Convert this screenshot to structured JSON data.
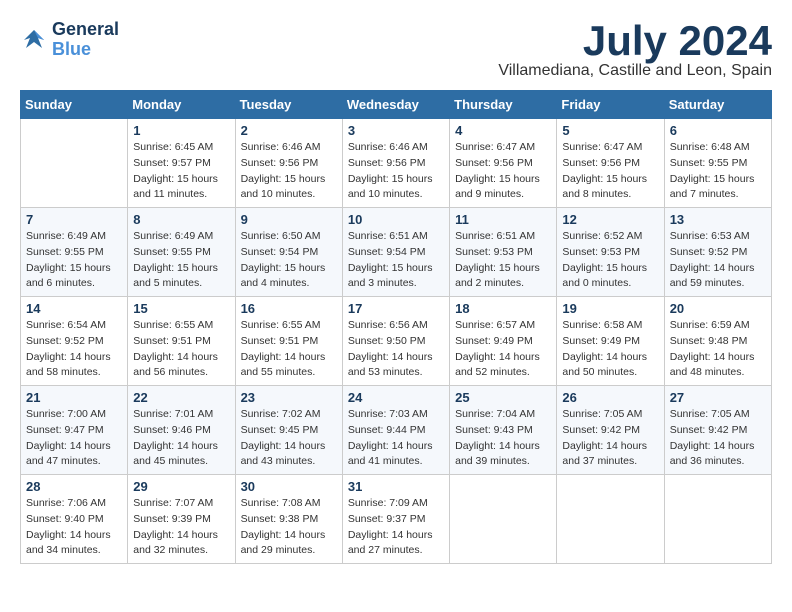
{
  "header": {
    "logo_line1": "General",
    "logo_line2": "Blue",
    "month_title": "July 2024",
    "location": "Villamediana, Castille and Leon, Spain"
  },
  "columns": [
    "Sunday",
    "Monday",
    "Tuesday",
    "Wednesday",
    "Thursday",
    "Friday",
    "Saturday"
  ],
  "weeks": [
    [
      {
        "day": "",
        "info": ""
      },
      {
        "day": "1",
        "info": "Sunrise: 6:45 AM\nSunset: 9:57 PM\nDaylight: 15 hours\nand 11 minutes."
      },
      {
        "day": "2",
        "info": "Sunrise: 6:46 AM\nSunset: 9:56 PM\nDaylight: 15 hours\nand 10 minutes."
      },
      {
        "day": "3",
        "info": "Sunrise: 6:46 AM\nSunset: 9:56 PM\nDaylight: 15 hours\nand 10 minutes."
      },
      {
        "day": "4",
        "info": "Sunrise: 6:47 AM\nSunset: 9:56 PM\nDaylight: 15 hours\nand 9 minutes."
      },
      {
        "day": "5",
        "info": "Sunrise: 6:47 AM\nSunset: 9:56 PM\nDaylight: 15 hours\nand 8 minutes."
      },
      {
        "day": "6",
        "info": "Sunrise: 6:48 AM\nSunset: 9:55 PM\nDaylight: 15 hours\nand 7 minutes."
      }
    ],
    [
      {
        "day": "7",
        "info": "Sunrise: 6:49 AM\nSunset: 9:55 PM\nDaylight: 15 hours\nand 6 minutes."
      },
      {
        "day": "8",
        "info": "Sunrise: 6:49 AM\nSunset: 9:55 PM\nDaylight: 15 hours\nand 5 minutes."
      },
      {
        "day": "9",
        "info": "Sunrise: 6:50 AM\nSunset: 9:54 PM\nDaylight: 15 hours\nand 4 minutes."
      },
      {
        "day": "10",
        "info": "Sunrise: 6:51 AM\nSunset: 9:54 PM\nDaylight: 15 hours\nand 3 minutes."
      },
      {
        "day": "11",
        "info": "Sunrise: 6:51 AM\nSunset: 9:53 PM\nDaylight: 15 hours\nand 2 minutes."
      },
      {
        "day": "12",
        "info": "Sunrise: 6:52 AM\nSunset: 9:53 PM\nDaylight: 15 hours\nand 0 minutes."
      },
      {
        "day": "13",
        "info": "Sunrise: 6:53 AM\nSunset: 9:52 PM\nDaylight: 14 hours\nand 59 minutes."
      }
    ],
    [
      {
        "day": "14",
        "info": "Sunrise: 6:54 AM\nSunset: 9:52 PM\nDaylight: 14 hours\nand 58 minutes."
      },
      {
        "day": "15",
        "info": "Sunrise: 6:55 AM\nSunset: 9:51 PM\nDaylight: 14 hours\nand 56 minutes."
      },
      {
        "day": "16",
        "info": "Sunrise: 6:55 AM\nSunset: 9:51 PM\nDaylight: 14 hours\nand 55 minutes."
      },
      {
        "day": "17",
        "info": "Sunrise: 6:56 AM\nSunset: 9:50 PM\nDaylight: 14 hours\nand 53 minutes."
      },
      {
        "day": "18",
        "info": "Sunrise: 6:57 AM\nSunset: 9:49 PM\nDaylight: 14 hours\nand 52 minutes."
      },
      {
        "day": "19",
        "info": "Sunrise: 6:58 AM\nSunset: 9:49 PM\nDaylight: 14 hours\nand 50 minutes."
      },
      {
        "day": "20",
        "info": "Sunrise: 6:59 AM\nSunset: 9:48 PM\nDaylight: 14 hours\nand 48 minutes."
      }
    ],
    [
      {
        "day": "21",
        "info": "Sunrise: 7:00 AM\nSunset: 9:47 PM\nDaylight: 14 hours\nand 47 minutes."
      },
      {
        "day": "22",
        "info": "Sunrise: 7:01 AM\nSunset: 9:46 PM\nDaylight: 14 hours\nand 45 minutes."
      },
      {
        "day": "23",
        "info": "Sunrise: 7:02 AM\nSunset: 9:45 PM\nDaylight: 14 hours\nand 43 minutes."
      },
      {
        "day": "24",
        "info": "Sunrise: 7:03 AM\nSunset: 9:44 PM\nDaylight: 14 hours\nand 41 minutes."
      },
      {
        "day": "25",
        "info": "Sunrise: 7:04 AM\nSunset: 9:43 PM\nDaylight: 14 hours\nand 39 minutes."
      },
      {
        "day": "26",
        "info": "Sunrise: 7:05 AM\nSunset: 9:42 PM\nDaylight: 14 hours\nand 37 minutes."
      },
      {
        "day": "27",
        "info": "Sunrise: 7:05 AM\nSunset: 9:42 PM\nDaylight: 14 hours\nand 36 minutes."
      }
    ],
    [
      {
        "day": "28",
        "info": "Sunrise: 7:06 AM\nSunset: 9:40 PM\nDaylight: 14 hours\nand 34 minutes."
      },
      {
        "day": "29",
        "info": "Sunrise: 7:07 AM\nSunset: 9:39 PM\nDaylight: 14 hours\nand 32 minutes."
      },
      {
        "day": "30",
        "info": "Sunrise: 7:08 AM\nSunset: 9:38 PM\nDaylight: 14 hours\nand 29 minutes."
      },
      {
        "day": "31",
        "info": "Sunrise: 7:09 AM\nSunset: 9:37 PM\nDaylight: 14 hours\nand 27 minutes."
      },
      {
        "day": "",
        "info": ""
      },
      {
        "day": "",
        "info": ""
      },
      {
        "day": "",
        "info": ""
      }
    ]
  ]
}
